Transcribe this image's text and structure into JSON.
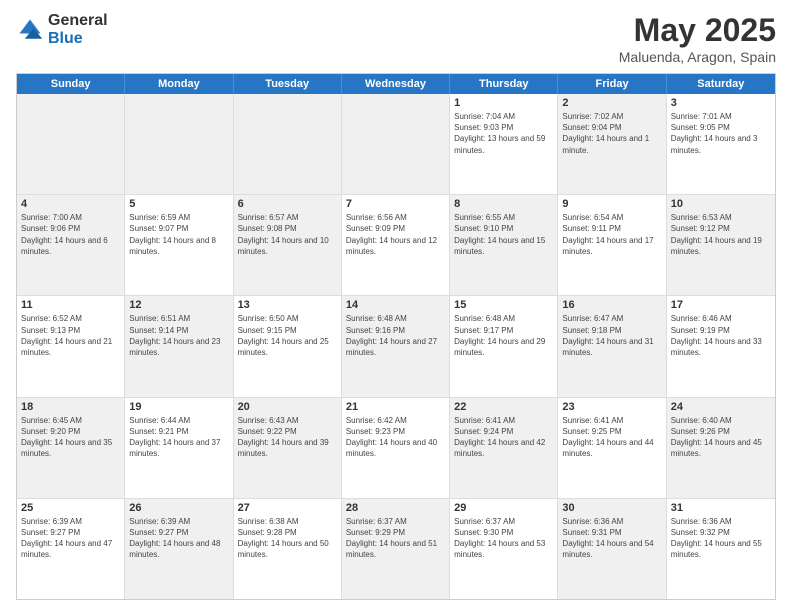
{
  "logo": {
    "general": "General",
    "blue": "Blue"
  },
  "title": {
    "month": "May 2025",
    "location": "Maluenda, Aragon, Spain"
  },
  "header_days": [
    "Sunday",
    "Monday",
    "Tuesday",
    "Wednesday",
    "Thursday",
    "Friday",
    "Saturday"
  ],
  "weeks": [
    [
      {
        "day": "",
        "info": "",
        "shaded": true
      },
      {
        "day": "",
        "info": "",
        "shaded": true
      },
      {
        "day": "",
        "info": "",
        "shaded": true
      },
      {
        "day": "",
        "info": "",
        "shaded": true
      },
      {
        "day": "1",
        "info": "Sunrise: 7:04 AM\nSunset: 9:03 PM\nDaylight: 13 hours and 59 minutes."
      },
      {
        "day": "2",
        "info": "Sunrise: 7:02 AM\nSunset: 9:04 PM\nDaylight: 14 hours and 1 minute.",
        "shaded": true
      },
      {
        "day": "3",
        "info": "Sunrise: 7:01 AM\nSunset: 9:05 PM\nDaylight: 14 hours and 3 minutes."
      }
    ],
    [
      {
        "day": "4",
        "info": "Sunrise: 7:00 AM\nSunset: 9:06 PM\nDaylight: 14 hours and 6 minutes.",
        "shaded": true
      },
      {
        "day": "5",
        "info": "Sunrise: 6:59 AM\nSunset: 9:07 PM\nDaylight: 14 hours and 8 minutes."
      },
      {
        "day": "6",
        "info": "Sunrise: 6:57 AM\nSunset: 9:08 PM\nDaylight: 14 hours and 10 minutes.",
        "shaded": true
      },
      {
        "day": "7",
        "info": "Sunrise: 6:56 AM\nSunset: 9:09 PM\nDaylight: 14 hours and 12 minutes."
      },
      {
        "day": "8",
        "info": "Sunrise: 6:55 AM\nSunset: 9:10 PM\nDaylight: 14 hours and 15 minutes.",
        "shaded": true
      },
      {
        "day": "9",
        "info": "Sunrise: 6:54 AM\nSunset: 9:11 PM\nDaylight: 14 hours and 17 minutes."
      },
      {
        "day": "10",
        "info": "Sunrise: 6:53 AM\nSunset: 9:12 PM\nDaylight: 14 hours and 19 minutes.",
        "shaded": true
      }
    ],
    [
      {
        "day": "11",
        "info": "Sunrise: 6:52 AM\nSunset: 9:13 PM\nDaylight: 14 hours and 21 minutes."
      },
      {
        "day": "12",
        "info": "Sunrise: 6:51 AM\nSunset: 9:14 PM\nDaylight: 14 hours and 23 minutes.",
        "shaded": true
      },
      {
        "day": "13",
        "info": "Sunrise: 6:50 AM\nSunset: 9:15 PM\nDaylight: 14 hours and 25 minutes."
      },
      {
        "day": "14",
        "info": "Sunrise: 6:48 AM\nSunset: 9:16 PM\nDaylight: 14 hours and 27 minutes.",
        "shaded": true
      },
      {
        "day": "15",
        "info": "Sunrise: 6:48 AM\nSunset: 9:17 PM\nDaylight: 14 hours and 29 minutes."
      },
      {
        "day": "16",
        "info": "Sunrise: 6:47 AM\nSunset: 9:18 PM\nDaylight: 14 hours and 31 minutes.",
        "shaded": true
      },
      {
        "day": "17",
        "info": "Sunrise: 6:46 AM\nSunset: 9:19 PM\nDaylight: 14 hours and 33 minutes."
      }
    ],
    [
      {
        "day": "18",
        "info": "Sunrise: 6:45 AM\nSunset: 9:20 PM\nDaylight: 14 hours and 35 minutes.",
        "shaded": true
      },
      {
        "day": "19",
        "info": "Sunrise: 6:44 AM\nSunset: 9:21 PM\nDaylight: 14 hours and 37 minutes."
      },
      {
        "day": "20",
        "info": "Sunrise: 6:43 AM\nSunset: 9:22 PM\nDaylight: 14 hours and 39 minutes.",
        "shaded": true
      },
      {
        "day": "21",
        "info": "Sunrise: 6:42 AM\nSunset: 9:23 PM\nDaylight: 14 hours and 40 minutes."
      },
      {
        "day": "22",
        "info": "Sunrise: 6:41 AM\nSunset: 9:24 PM\nDaylight: 14 hours and 42 minutes.",
        "shaded": true
      },
      {
        "day": "23",
        "info": "Sunrise: 6:41 AM\nSunset: 9:25 PM\nDaylight: 14 hours and 44 minutes."
      },
      {
        "day": "24",
        "info": "Sunrise: 6:40 AM\nSunset: 9:26 PM\nDaylight: 14 hours and 45 minutes.",
        "shaded": true
      }
    ],
    [
      {
        "day": "25",
        "info": "Sunrise: 6:39 AM\nSunset: 9:27 PM\nDaylight: 14 hours and 47 minutes."
      },
      {
        "day": "26",
        "info": "Sunrise: 6:39 AM\nSunset: 9:27 PM\nDaylight: 14 hours and 48 minutes.",
        "shaded": true
      },
      {
        "day": "27",
        "info": "Sunrise: 6:38 AM\nSunset: 9:28 PM\nDaylight: 14 hours and 50 minutes."
      },
      {
        "day": "28",
        "info": "Sunrise: 6:37 AM\nSunset: 9:29 PM\nDaylight: 14 hours and 51 minutes.",
        "shaded": true
      },
      {
        "day": "29",
        "info": "Sunrise: 6:37 AM\nSunset: 9:30 PM\nDaylight: 14 hours and 53 minutes."
      },
      {
        "day": "30",
        "info": "Sunrise: 6:36 AM\nSunset: 9:31 PM\nDaylight: 14 hours and 54 minutes.",
        "shaded": true
      },
      {
        "day": "31",
        "info": "Sunrise: 6:36 AM\nSunset: 9:32 PM\nDaylight: 14 hours and 55 minutes."
      }
    ]
  ]
}
